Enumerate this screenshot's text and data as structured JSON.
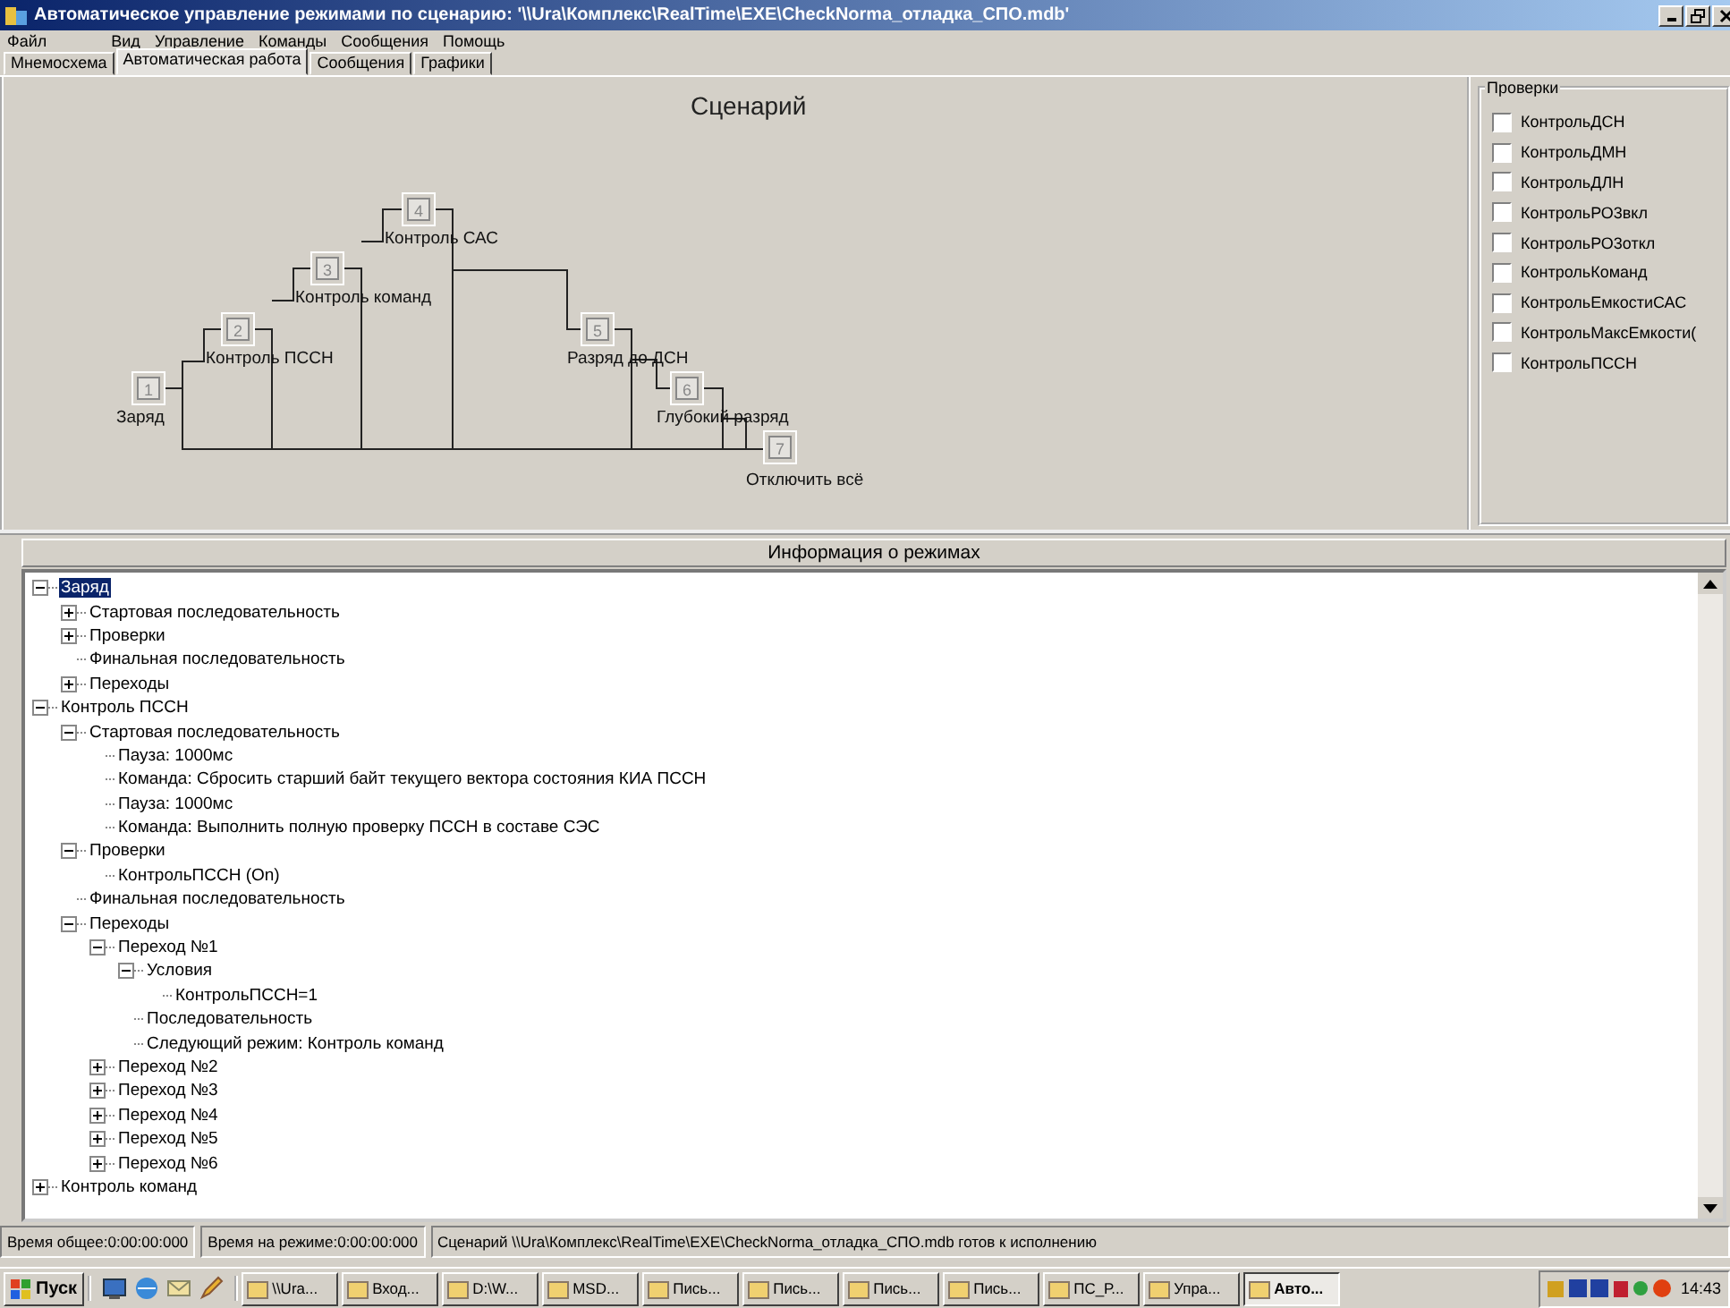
{
  "window": {
    "title": "Автоматическое управление режимами по сценарию: '\\\\Ura\\Комплекс\\RealTime\\EXE\\CheckNorma_отладка_СПО.mdb'"
  },
  "menu": [
    "Файл",
    "Вид",
    "Управление",
    "Команды",
    "Сообщения",
    "Помощь"
  ],
  "tabs": [
    {
      "label": "Мнемосхема",
      "selected": false
    },
    {
      "label": "Автоматическая работа",
      "selected": true
    },
    {
      "label": "Сообщения",
      "selected": false
    },
    {
      "label": "Графики",
      "selected": false
    }
  ],
  "scenario": {
    "title": "Сценарий",
    "steps": [
      {
        "number": "1",
        "label": "Заряд"
      },
      {
        "number": "2",
        "label": "Контроль ПССН"
      },
      {
        "number": "3",
        "label": "Контроль команд"
      },
      {
        "number": "4",
        "label": "Контроль САС"
      },
      {
        "number": "5",
        "label": "Разряд до ДСН"
      },
      {
        "number": "6",
        "label": "Глубокий разряд"
      },
      {
        "number": "7",
        "label": "Отключить всё"
      }
    ]
  },
  "checks": {
    "title": "Проверки",
    "items": [
      {
        "label": "КонтрольДСН",
        "checked": false
      },
      {
        "label": "КонтрольДМН",
        "checked": false
      },
      {
        "label": "КонтрольДЛН",
        "checked": false
      },
      {
        "label": "КонтрольРО3вкл",
        "checked": false
      },
      {
        "label": "КонтрольРО3откл",
        "checked": false
      },
      {
        "label": "КонтрольКоманд",
        "checked": false
      },
      {
        "label": "КонтрольЕмкостиСАС",
        "checked": false
      },
      {
        "label": "КонтрольМаксЕмкости(",
        "checked": false
      },
      {
        "label": "КонтрольПССН",
        "checked": false
      }
    ]
  },
  "info": {
    "title": "Информация о режимах",
    "tree": [
      {
        "label": "Заряд",
        "selected": true,
        "expanded": true,
        "children": [
          {
            "label": "Стартовая последовательность",
            "selected": false,
            "expanded": false
          },
          {
            "label": "Проверки",
            "selected": false,
            "expanded": false
          },
          {
            "label": "Финальная последовательность",
            "selected": false
          },
          {
            "label": "Переходы",
            "selected": false,
            "expanded": false
          }
        ]
      },
      {
        "label": "Контроль ПССН",
        "selected": false,
        "expanded": true,
        "children": [
          {
            "label": "Стартовая последовательность",
            "selected": false,
            "expanded": true,
            "children": [
              {
                "label": "Пауза: 1000мс",
                "selected": false
              },
              {
                "label": "Команда: Сбросить старший байт текущего вектора состояния КИА ПССН",
                "selected": false
              },
              {
                "label": "Пауза: 1000мс",
                "selected": false
              },
              {
                "label": "Команда: Выполнить полную проверку ПССН в составе СЭС",
                "selected": false
              }
            ]
          },
          {
            "label": "Проверки",
            "selected": false,
            "expanded": true,
            "children": [
              {
                "label": "КонтрольПССН  (On)",
                "selected": false
              }
            ]
          },
          {
            "label": "Финальная последовательность",
            "selected": false
          },
          {
            "label": "Переходы",
            "selected": false,
            "expanded": true,
            "children": [
              {
                "label": "Переход №1",
                "selected": false,
                "expanded": true,
                "children": [
                  {
                    "label": "Условия",
                    "selected": false,
                    "expanded": true,
                    "children": [
                      {
                        "label": "КонтрольПССН=1",
                        "selected": false
                      }
                    ]
                  },
                  {
                    "label": "Последовательность",
                    "selected": false
                  },
                  {
                    "label": "Следующий режим: Контроль команд",
                    "selected": false
                  }
                ]
              },
              {
                "label": "Переход №2",
                "selected": false,
                "expanded": false
              },
              {
                "label": "Переход №3",
                "selected": false,
                "expanded": false
              },
              {
                "label": "Переход №4",
                "selected": false,
                "expanded": false
              },
              {
                "label": "Переход №5",
                "selected": false,
                "expanded": false
              },
              {
                "label": "Переход №6",
                "selected": false,
                "expanded": false
              }
            ]
          }
        ]
      },
      {
        "label": "Контроль команд",
        "selected": false,
        "expanded": false
      }
    ]
  },
  "status_bar": [
    "Время общее:0:00:00:000",
    "Время на режиме:0:00:00:000",
    "Сценарий \\\\Ura\\Комплекс\\RealTime\\EXE\\CheckNorma_отладка_СПО.mdb готов к исполнению"
  ],
  "taskbar": {
    "start": "Пуск",
    "tasks": [
      {
        "label": "\\\\Ura...",
        "selected": false
      },
      {
        "label": "Вход...",
        "selected": false
      },
      {
        "label": "D:\\W...",
        "selected": false
      },
      {
        "label": "MSD...",
        "selected": false
      },
      {
        "label": "Пись...",
        "selected": false
      },
      {
        "label": "Пись...",
        "selected": false
      },
      {
        "label": "Пись...",
        "selected": false
      },
      {
        "label": "Пись...",
        "selected": false
      },
      {
        "label": "ПС_Р...",
        "selected": false
      },
      {
        "label": "Упра...",
        "selected": false
      },
      {
        "label": "Авто...",
        "selected": true
      }
    ],
    "clock": "14:43"
  }
}
